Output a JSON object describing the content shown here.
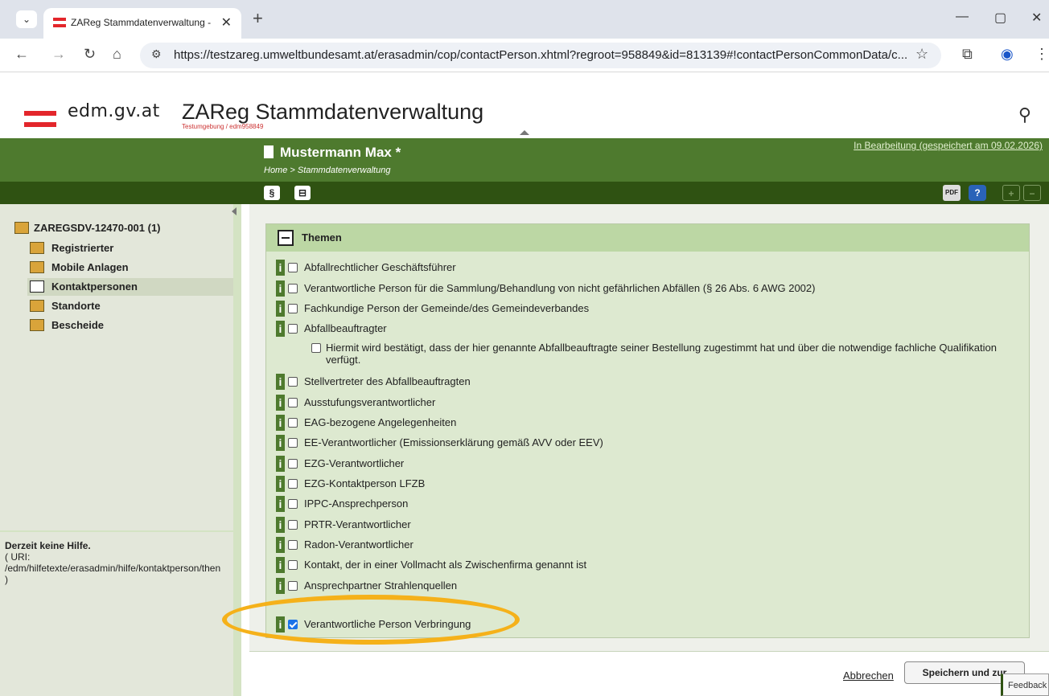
{
  "browser": {
    "tab_title": "ZAReg Stammdatenverwaltung - Must",
    "url": "https://testzareg.umweltbundesamt.at/erasadmin/cop/contactPerson.xhtml?regroot=958849&id=813139#!contactPersonCommonData/c..."
  },
  "header": {
    "logo_text": "edm.gv.at",
    "title": "ZAReg Stammdatenverwaltung",
    "subtitle": "Testumgebung / edm958849"
  },
  "banner": {
    "person": "Mustermann Max *",
    "breadcrumb": "Home > Stammdatenverwaltung",
    "status": "In Bearbeitung (gespeichert am 09.02.2026)"
  },
  "toolbar": {
    "paragraph_icon": "§",
    "save_icon": "⊟",
    "pdf_icon": "PDF",
    "help_icon": "?",
    "expand_icon": "+",
    "collapse_icon": "−"
  },
  "sidebar": {
    "root": "ZAREGSDV-12470-001 (1)",
    "items": [
      {
        "label": "Registrierter"
      },
      {
        "label": "Mobile Anlagen"
      },
      {
        "label": "Kontaktpersonen"
      },
      {
        "label": "Standorte"
      },
      {
        "label": "Bescheide"
      }
    ],
    "help_title": "Derzeit keine Hilfe.",
    "help_uri_label": "( URI:",
    "help_uri": "/edm/hilfetexte/erasadmin/hilfe/kontaktperson/then",
    "help_close": ")"
  },
  "section": {
    "title": "Themen",
    "info_letter": "i",
    "items": [
      {
        "label": "Abfallrechtlicher Geschäftsführer",
        "checked": false
      },
      {
        "label": "Verantwortliche Person für die Sammlung/Behandlung von nicht gefährlichen Abfällen (§ 26 Abs. 6 AWG 2002)",
        "checked": false
      },
      {
        "label": "Fachkundige Person der Gemeinde/des Gemeindeverbandes",
        "checked": false
      },
      {
        "label": "Abfallbeauftragter",
        "checked": false
      },
      {
        "label": "Stellvertreter des Abfallbeauftragten",
        "checked": false
      },
      {
        "label": "Ausstufungsverantwortlicher",
        "checked": false
      },
      {
        "label": "EAG-bezogene Angelegenheiten",
        "checked": false
      },
      {
        "label": "EE-Verantwortlicher (Emissionserklärung gemäß AVV oder EEV)",
        "checked": false
      },
      {
        "label": "EZG-Verantwortlicher",
        "checked": false
      },
      {
        "label": "EZG-Kontaktperson LFZB",
        "checked": false
      },
      {
        "label": "IPPC-Ansprechperson",
        "checked": false
      },
      {
        "label": "PRTR-Verantwortlicher",
        "checked": false
      },
      {
        "label": "Radon-Verantwortlicher",
        "checked": false
      },
      {
        "label": "Kontakt, der in einer Vollmacht als Zwischenfirma genannt ist",
        "checked": false
      },
      {
        "label": "Ansprechpartner Strahlenquellen",
        "checked": false
      },
      {
        "label": "Verantwortliche Person Verbringung",
        "checked": true
      }
    ],
    "sub_item": "Hiermit wird bestätigt, dass der hier genannte Abfallbeauftragte seiner Bestellung zugestimmt hat und über die notwendige fachliche Qualifikation verfügt."
  },
  "footer": {
    "cancel": "Abbrechen",
    "save": "Speichern und zur"
  },
  "feedback": "Feedback",
  "colors": {
    "green_dark": "#2f5212",
    "green": "#4e7a2e",
    "highlight": "#f5b11a"
  }
}
